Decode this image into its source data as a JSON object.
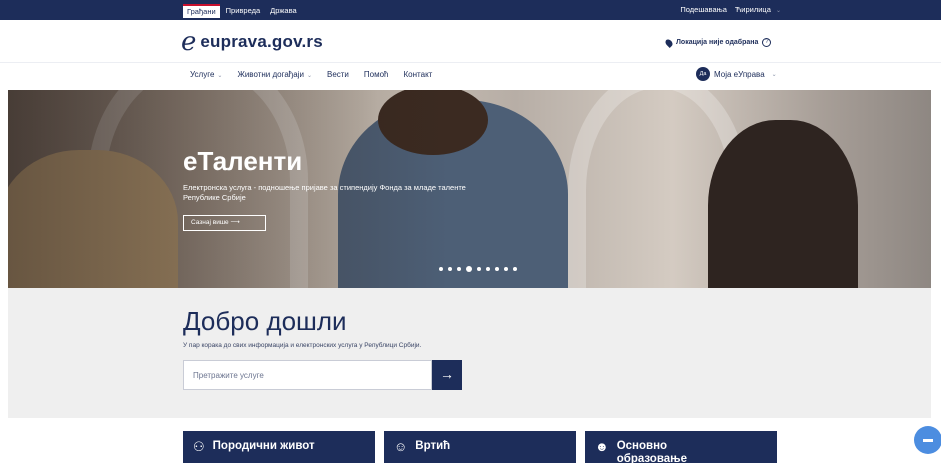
{
  "topbar": {
    "tabs": [
      {
        "label": "Грађани",
        "active": true
      },
      {
        "label": "Привреда",
        "active": false
      },
      {
        "label": "Држава",
        "active": false
      }
    ],
    "settings_label": "Подешавања",
    "language_label": "Ћирилица"
  },
  "header": {
    "logo_text": "euprava.gov.rs",
    "location_label": "Локација није одабрана",
    "help_glyph": "?"
  },
  "nav": {
    "items": [
      {
        "label": "Услуге",
        "has_dropdown": true
      },
      {
        "label": "Животни догађаји",
        "has_dropdown": true
      },
      {
        "label": "Вести",
        "has_dropdown": false
      },
      {
        "label": "Помоћ",
        "has_dropdown": false
      },
      {
        "label": "Контакт",
        "has_dropdown": false
      }
    ],
    "account_label": "Моја еУправа",
    "account_avatar": "Да"
  },
  "hero": {
    "title": "еТаленти",
    "subtitle": "Електронска услуга - подношење пријаве за стипендију Фонда за младе таленте Републике Србије",
    "button_label": "Сазнај више",
    "slide_count": 9,
    "active_slide": 3
  },
  "welcome": {
    "title": "Добро дошли",
    "subtitle": "У пар корака до свих информација и електронских услуга у Републици Србији.",
    "search_placeholder": "Претражите услуге"
  },
  "cards": [
    {
      "label": "Породични живот",
      "icon": "family-icon"
    },
    {
      "label": "Вртић",
      "icon": "kindergarten-icon"
    },
    {
      "label": "Основно образовање",
      "icon": "student-icon"
    }
  ],
  "colors": {
    "brand_navy": "#1d2d5a",
    "active_tab_accent": "#c8102e",
    "chat_button": "#4c8de0",
    "welcome_bg": "#efefef"
  }
}
